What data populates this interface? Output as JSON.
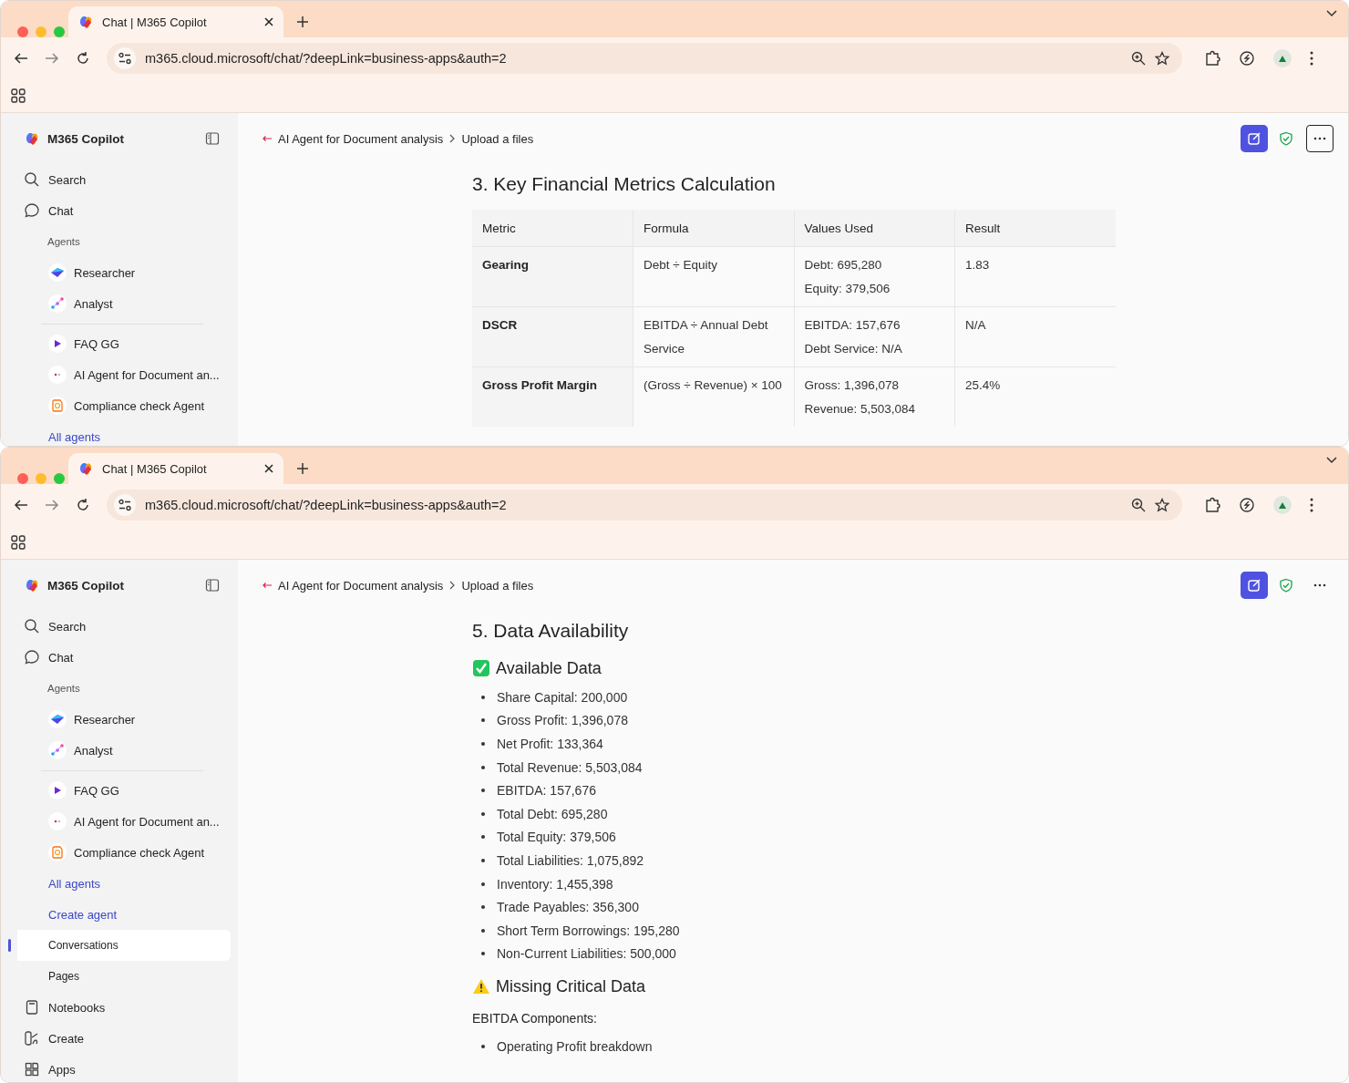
{
  "windows": [
    {
      "tab": {
        "title": "Chat | M365 Copilot"
      },
      "url": "m365.cloud.microsoft/chat/?deepLink=business-apps&auth=2",
      "app_title": "M365 Copilot",
      "sidebar": [
        {
          "kind": "nav",
          "label": "Search",
          "selected": false
        },
        {
          "kind": "nav",
          "label": "Chat",
          "selected": false
        },
        {
          "kind": "section",
          "label": "Agents"
        },
        {
          "kind": "agent",
          "label": "Researcher",
          "selected": false
        },
        {
          "kind": "agent",
          "label": "Analyst",
          "selected": false
        },
        {
          "kind": "divider"
        },
        {
          "kind": "agent",
          "label": "FAQ GG",
          "selected": false
        },
        {
          "kind": "agent",
          "label": "AI Agent for Document an...",
          "selected": false
        },
        {
          "kind": "agent",
          "label": "Compliance check Agent",
          "selected": false
        },
        {
          "kind": "link",
          "label": "All agents",
          "selected": false
        }
      ],
      "breadcrumb": [
        "AI Agent for Document analysis",
        "Upload a files"
      ],
      "more_focused": true,
      "content": [
        {
          "kind": "heading",
          "text": "3. Key Financial Metrics Calculation"
        },
        {
          "kind": "table",
          "columns": [
            "Metric",
            "Formula",
            "Values Used",
            "Result"
          ],
          "rows": [
            [
              [
                "Gearing"
              ],
              [
                "Debt ÷ Equity"
              ],
              [
                "Debt: 695,280",
                "Equity: 379,506"
              ],
              [
                "1.83"
              ]
            ],
            [
              [
                "DSCR"
              ],
              [
                "EBITDA ÷ Annual Debt Service"
              ],
              [
                "EBITDA: 157,676",
                "Debt Service: N/A"
              ],
              [
                "N/A"
              ]
            ],
            [
              [
                "Gross Profit Margin"
              ],
              [
                "(Gross ÷ Revenue) × 100"
              ],
              [
                "Gross: 1,396,078",
                "Revenue: 5,503,084"
              ],
              [
                "25.4%"
              ]
            ]
          ]
        }
      ]
    },
    {
      "tab": {
        "title": "Chat | M365 Copilot"
      },
      "url": "m365.cloud.microsoft/chat/?deepLink=business-apps&auth=2",
      "app_title": "M365 Copilot",
      "sidebar": [
        {
          "kind": "nav",
          "label": "Search",
          "selected": false
        },
        {
          "kind": "nav",
          "label": "Chat",
          "selected": false
        },
        {
          "kind": "section",
          "label": "Agents"
        },
        {
          "kind": "agent",
          "label": "Researcher",
          "selected": false
        },
        {
          "kind": "agent",
          "label": "Analyst",
          "selected": false
        },
        {
          "kind": "divider"
        },
        {
          "kind": "agent",
          "label": "FAQ GG",
          "selected": false
        },
        {
          "kind": "agent",
          "label": "AI Agent for Document an...",
          "selected": false
        },
        {
          "kind": "agent",
          "label": "Compliance check Agent",
          "selected": false
        },
        {
          "kind": "link",
          "label": "All agents",
          "selected": false
        },
        {
          "kind": "link",
          "label": "Create agent",
          "selected": false
        },
        {
          "kind": "subnav",
          "label": "Conversations",
          "selected": true
        },
        {
          "kind": "subnav",
          "label": "Pages",
          "selected": false
        },
        {
          "kind": "nav",
          "label": "Notebooks",
          "selected": false
        },
        {
          "kind": "nav",
          "label": "Create",
          "selected": false
        },
        {
          "kind": "nav",
          "label": "Apps",
          "selected": false
        }
      ],
      "breadcrumb": [
        "AI Agent for Document analysis",
        "Upload a files"
      ],
      "more_focused": false,
      "content": [
        {
          "kind": "heading",
          "text": "5. Data Availability"
        },
        {
          "kind": "available-heading",
          "text": "Available Data"
        },
        {
          "kind": "bullets",
          "items": [
            "Share Capital: 200,000",
            "Gross Profit: 1,396,078",
            "Net Profit: 133,364",
            "Total Revenue: 5,503,084",
            "EBITDA: 157,676",
            "Total Debt: 695,280",
            "Total Equity: 379,506",
            "Total Liabilities: 1,075,892",
            "Inventory: 1,455,398",
            "Trade Payables: 356,300",
            "Short Term Borrowings: 195,280",
            "Non-Current Liabilities: 500,000"
          ]
        },
        {
          "kind": "missing-heading",
          "text": "Missing Critical Data"
        },
        {
          "kind": "paragraph",
          "text": "EBITDA Components:"
        },
        {
          "kind": "bullets",
          "items": [
            "Operating Profit breakdown"
          ]
        }
      ]
    }
  ]
}
